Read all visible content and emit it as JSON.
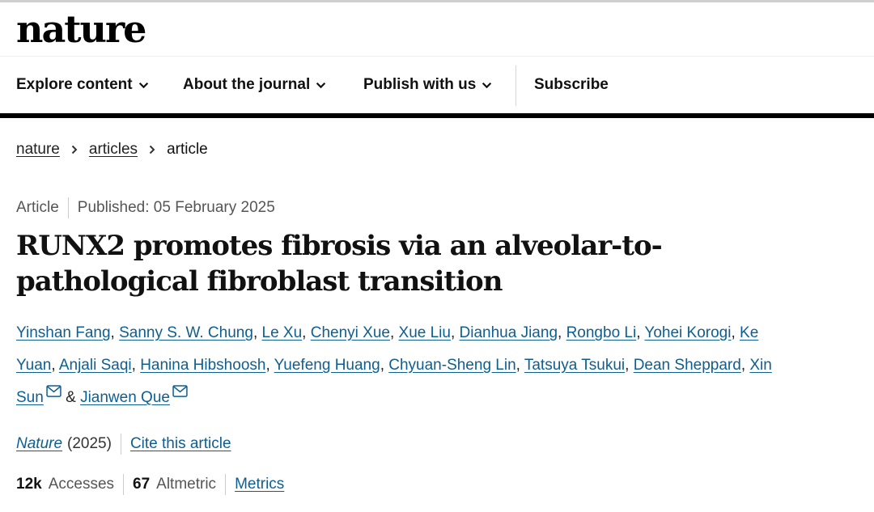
{
  "header": {
    "logo": "nature",
    "nav": [
      {
        "label": "Explore content",
        "icon": "chevron-down-icon"
      },
      {
        "label": "About the journal",
        "icon": "chevron-down-icon"
      },
      {
        "label": "Publish with us",
        "icon": "chevron-down-icon"
      },
      {
        "label": "Subscribe"
      }
    ]
  },
  "breadcrumb": {
    "items": [
      "nature",
      "articles"
    ],
    "current": "article"
  },
  "article": {
    "type": "Article",
    "published": "Published: 05 February 2025",
    "title": "RUNX2 promotes fibrosis via an alveolar-to-pathological fibroblast transition",
    "authors": [
      "Yinshan Fang",
      "Sanny S. W. Chung",
      "Le Xu",
      "Chenyi Xue",
      "Xue Liu",
      "Dianhua Jiang",
      "Rongbo Li",
      "Yohei Korogi",
      "Ke Yuan",
      "Anjali Saqi",
      "Hanina Hibshoosh",
      "Yuefeng Huang",
      "Chyuan-Sheng Lin",
      "Tatsuya Tsukui",
      "Dean Sheppard",
      "Xin Sun",
      "Jianwen Que"
    ],
    "author_separator": ", ",
    "author_conjunction": "&",
    "journal": "Nature",
    "year": "(2025)",
    "cite_label": "Cite this article"
  },
  "metrics": {
    "accesses_value": "12k",
    "accesses_label": "Accesses",
    "altmetric_value": "67",
    "altmetric_label": "Altmetric",
    "metrics_link": "Metrics"
  },
  "colors": {
    "link": "#0e5e91",
    "text": "#222222",
    "muted": "#555555",
    "rule": "#000000"
  }
}
